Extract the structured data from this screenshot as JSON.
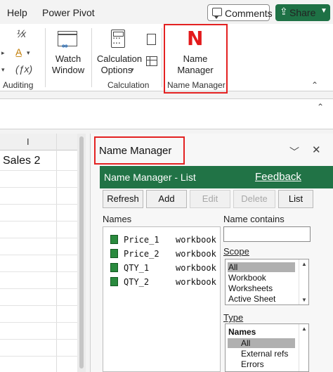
{
  "menu": {
    "help": "Help",
    "power_pivot": "Power Pivot",
    "comments": "Comments",
    "share": "Share"
  },
  "ribbon": {
    "auditing_label": "Auditing",
    "watch_window": "Watch\nWindow",
    "watch_line1": "Watch",
    "watch_line2": "Window",
    "calc_line1": "Calculation",
    "calc_line2": "Options",
    "calculation_label": "Calculation",
    "name_manager_line1": "Name",
    "name_manager_line2": "Manager",
    "name_manager_label": "Name Manager",
    "name_manager_icon": "N"
  },
  "sheet": {
    "column": "I",
    "cell_text": "Sales 2"
  },
  "pane": {
    "title": "Name Manager",
    "header_title": "Name Manager - List",
    "feedback": "Feedback",
    "buttons": {
      "refresh": "Refresh",
      "add": "Add",
      "edit": "Edit",
      "delete": "Delete",
      "list": "List"
    },
    "names_label": "Names",
    "names": [
      {
        "name": "Price_1",
        "scope": "workbook"
      },
      {
        "name": "Price_2",
        "scope": "workbook"
      },
      {
        "name": "QTY_1",
        "scope": "workbook"
      },
      {
        "name": "QTY_2",
        "scope": "workbook"
      }
    ],
    "name_contains_label": "Name contains",
    "name_contains_value": "",
    "scope_label": "Scope",
    "scope_options": [
      "All",
      "Workbook",
      "Worksheets",
      "Active Sheet"
    ],
    "scope_selected": "All",
    "type_label": "Type",
    "type_options": [
      "Names",
      "All",
      "External refs",
      "Errors"
    ],
    "type_selected": "All"
  },
  "colors": {
    "excel_green": "#217346",
    "share_green": "#1e7145",
    "highlight_red": "#e32121"
  }
}
